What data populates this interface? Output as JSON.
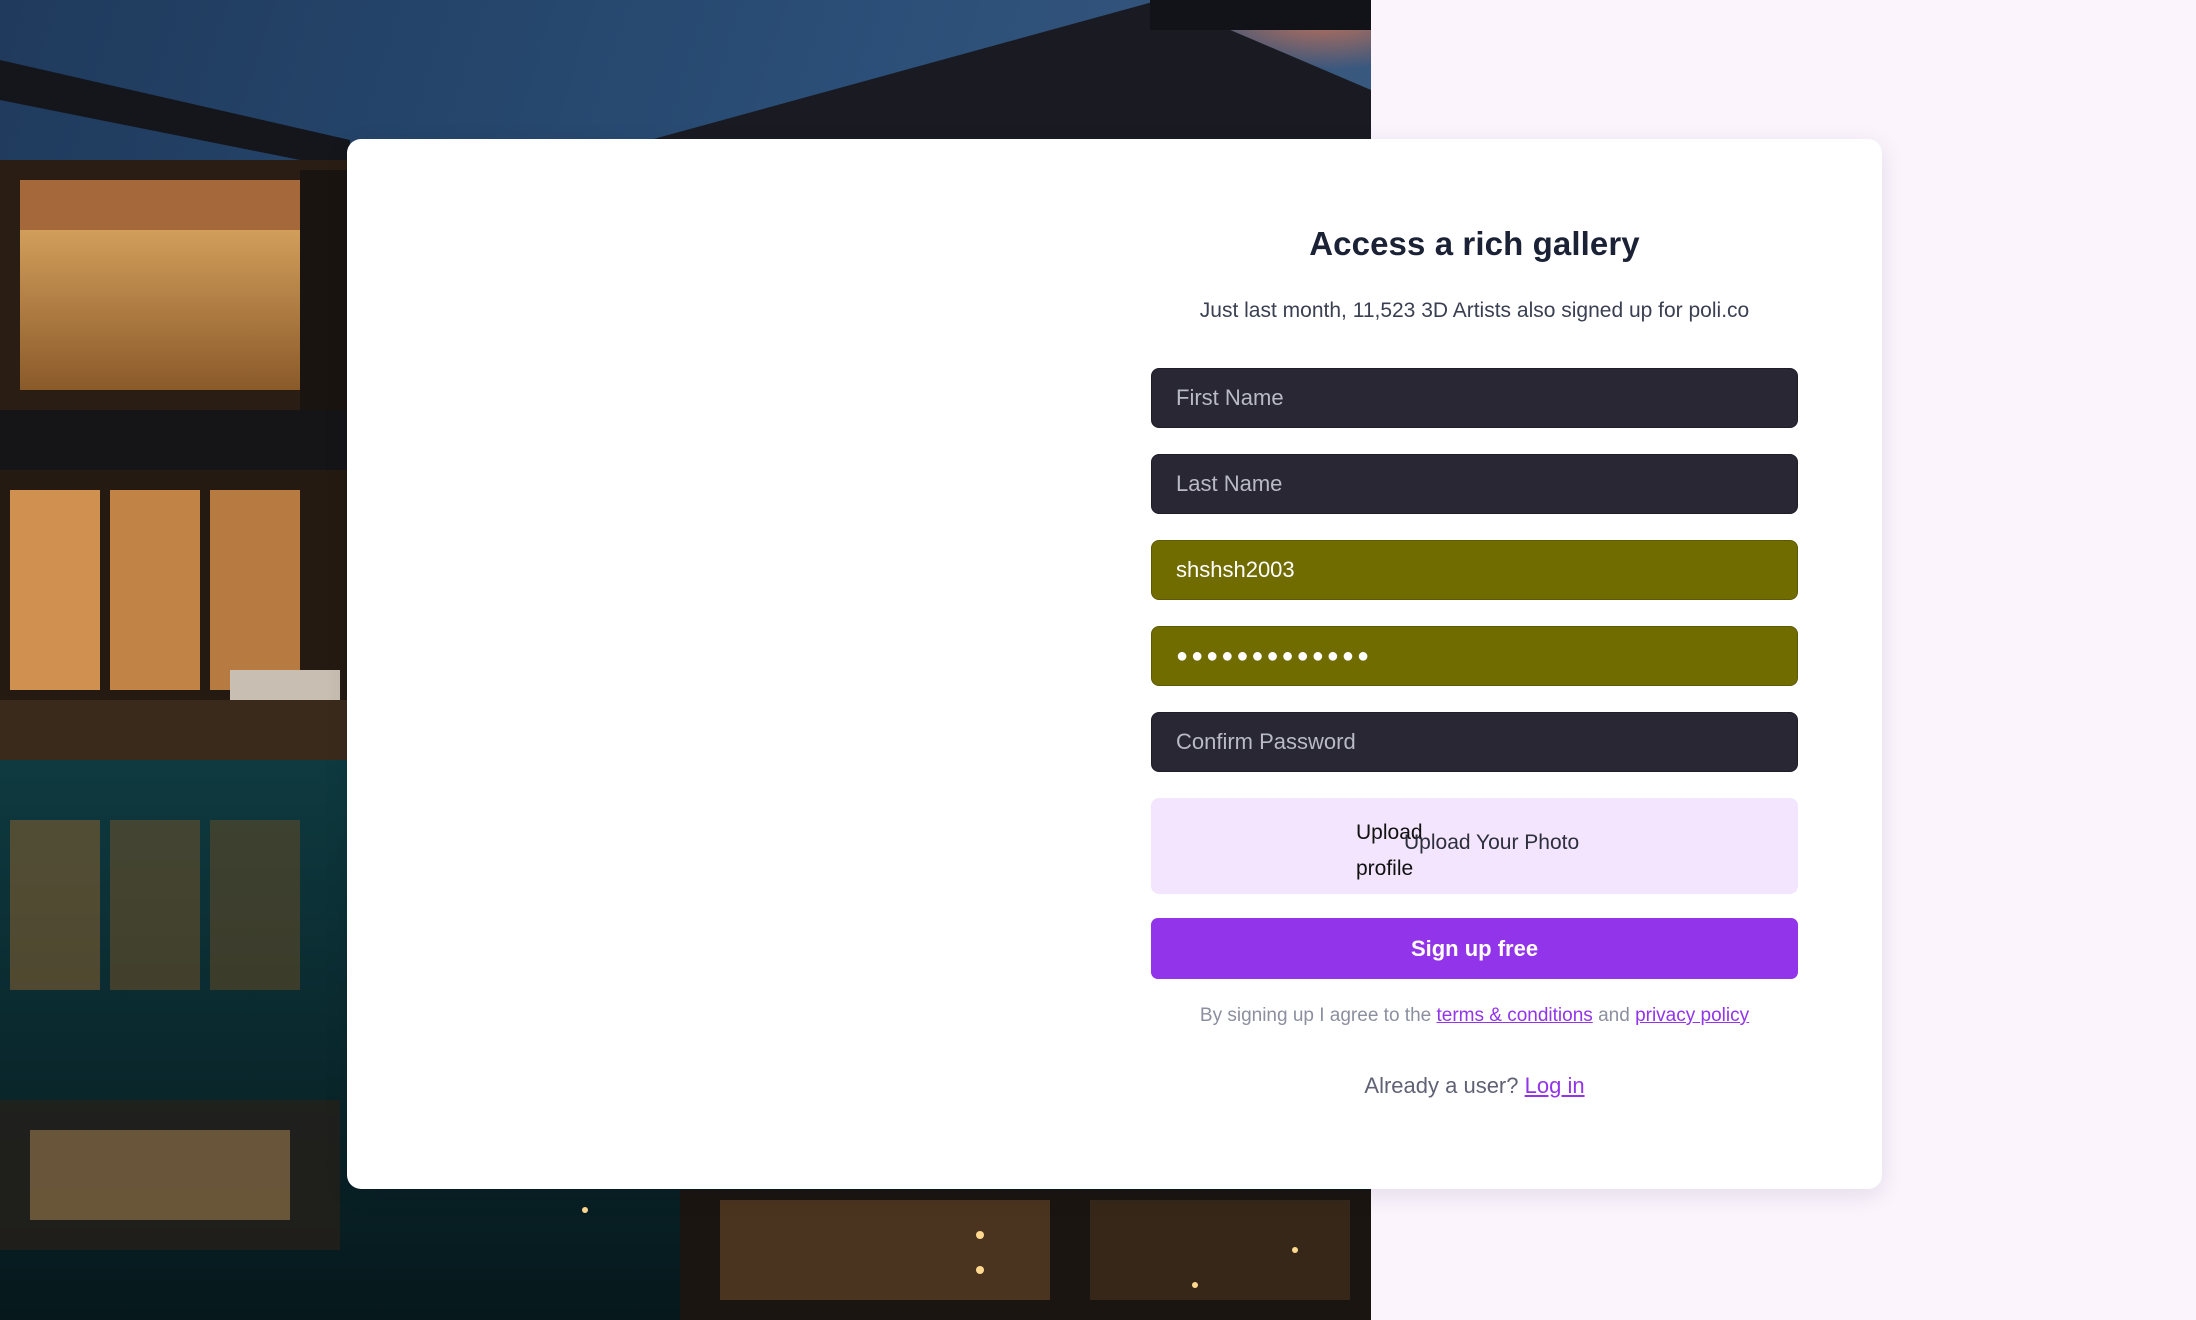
{
  "form": {
    "title": "Access a rich gallery",
    "subtitle": "Just last month, 11,523 3D Artists also signed up for poli.co",
    "first_name": {
      "placeholder": "First Name",
      "value": ""
    },
    "last_name": {
      "placeholder": "Last Name",
      "value": ""
    },
    "username": {
      "value": "shshsh2003"
    },
    "password": {
      "value": "●●●●●●●●●●●●●"
    },
    "confirm_password": {
      "placeholder": "Confirm Password",
      "value": ""
    },
    "upload": {
      "image_alt": "Upload profile",
      "label": "Upload Your Photo"
    },
    "submit_label": "Sign up free",
    "terms": {
      "prefix": "By signing up I agree to the",
      "terms_link": "terms & conditions",
      "and": "and",
      "privacy_link": "privacy policy"
    },
    "login": {
      "prompt": "Already a user?",
      "link": "Log in"
    }
  },
  "colors": {
    "accent": "#9234ea",
    "input_dark": "#282733",
    "input_autofill": "#716c00",
    "upload_bg": "#f2e5fd",
    "page_bg": "#fbf4fd"
  },
  "background": {
    "image": "modern house at dusk with illuminated glass walls and pool reflection"
  }
}
